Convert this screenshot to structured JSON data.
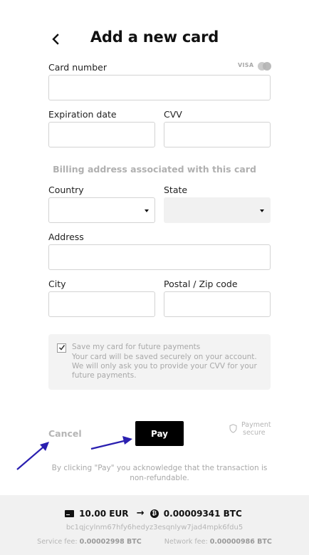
{
  "header": {
    "title": "Add a new card"
  },
  "card_number": {
    "label": "Card number",
    "value": "",
    "brands": {
      "visa": "VISA",
      "mastercard_icon": "mastercard-icon"
    }
  },
  "expiration": {
    "label": "Expiration date",
    "value": ""
  },
  "cvv": {
    "label": "CVV",
    "value": ""
  },
  "billing": {
    "heading": "Billing address associated with this card"
  },
  "country": {
    "label": "Country",
    "value": ""
  },
  "state": {
    "label": "State",
    "value": ""
  },
  "address": {
    "label": "Address",
    "value": ""
  },
  "city": {
    "label": "City",
    "value": ""
  },
  "postal": {
    "label": "Postal / Zip code",
    "value": ""
  },
  "save_card": {
    "checked": true,
    "title": "Save my card for future payments",
    "description": "Your card will be saved securely on your account. We will only ask you to provide your CVV for your future payments."
  },
  "actions": {
    "cancel_label": "Cancel",
    "pay_label": "Pay",
    "secure_line1": "Payment",
    "secure_line2": "secure"
  },
  "disclaimer": "By clicking \"Pay\" you acknowledge that the transaction is non-refundable.",
  "conversion": {
    "from_amount": "10.00 EUR",
    "arrow": "→",
    "btc_symbol": "₿",
    "to_amount": "0.00009341 BTC",
    "address": "bc1qjcylnm67hfy6hedyz3esqnlyw7jad4mpk6fdu5",
    "service_fee_label": "Service fee:",
    "service_fee": "0.00002998 BTC",
    "network_fee_label": "Network fee:",
    "network_fee": "0.00000986 BTC"
  },
  "colors": {
    "annotation_arrow": "#2a1fb0",
    "pay_button": "#000000",
    "footer_bg": "#f1f1f1"
  }
}
